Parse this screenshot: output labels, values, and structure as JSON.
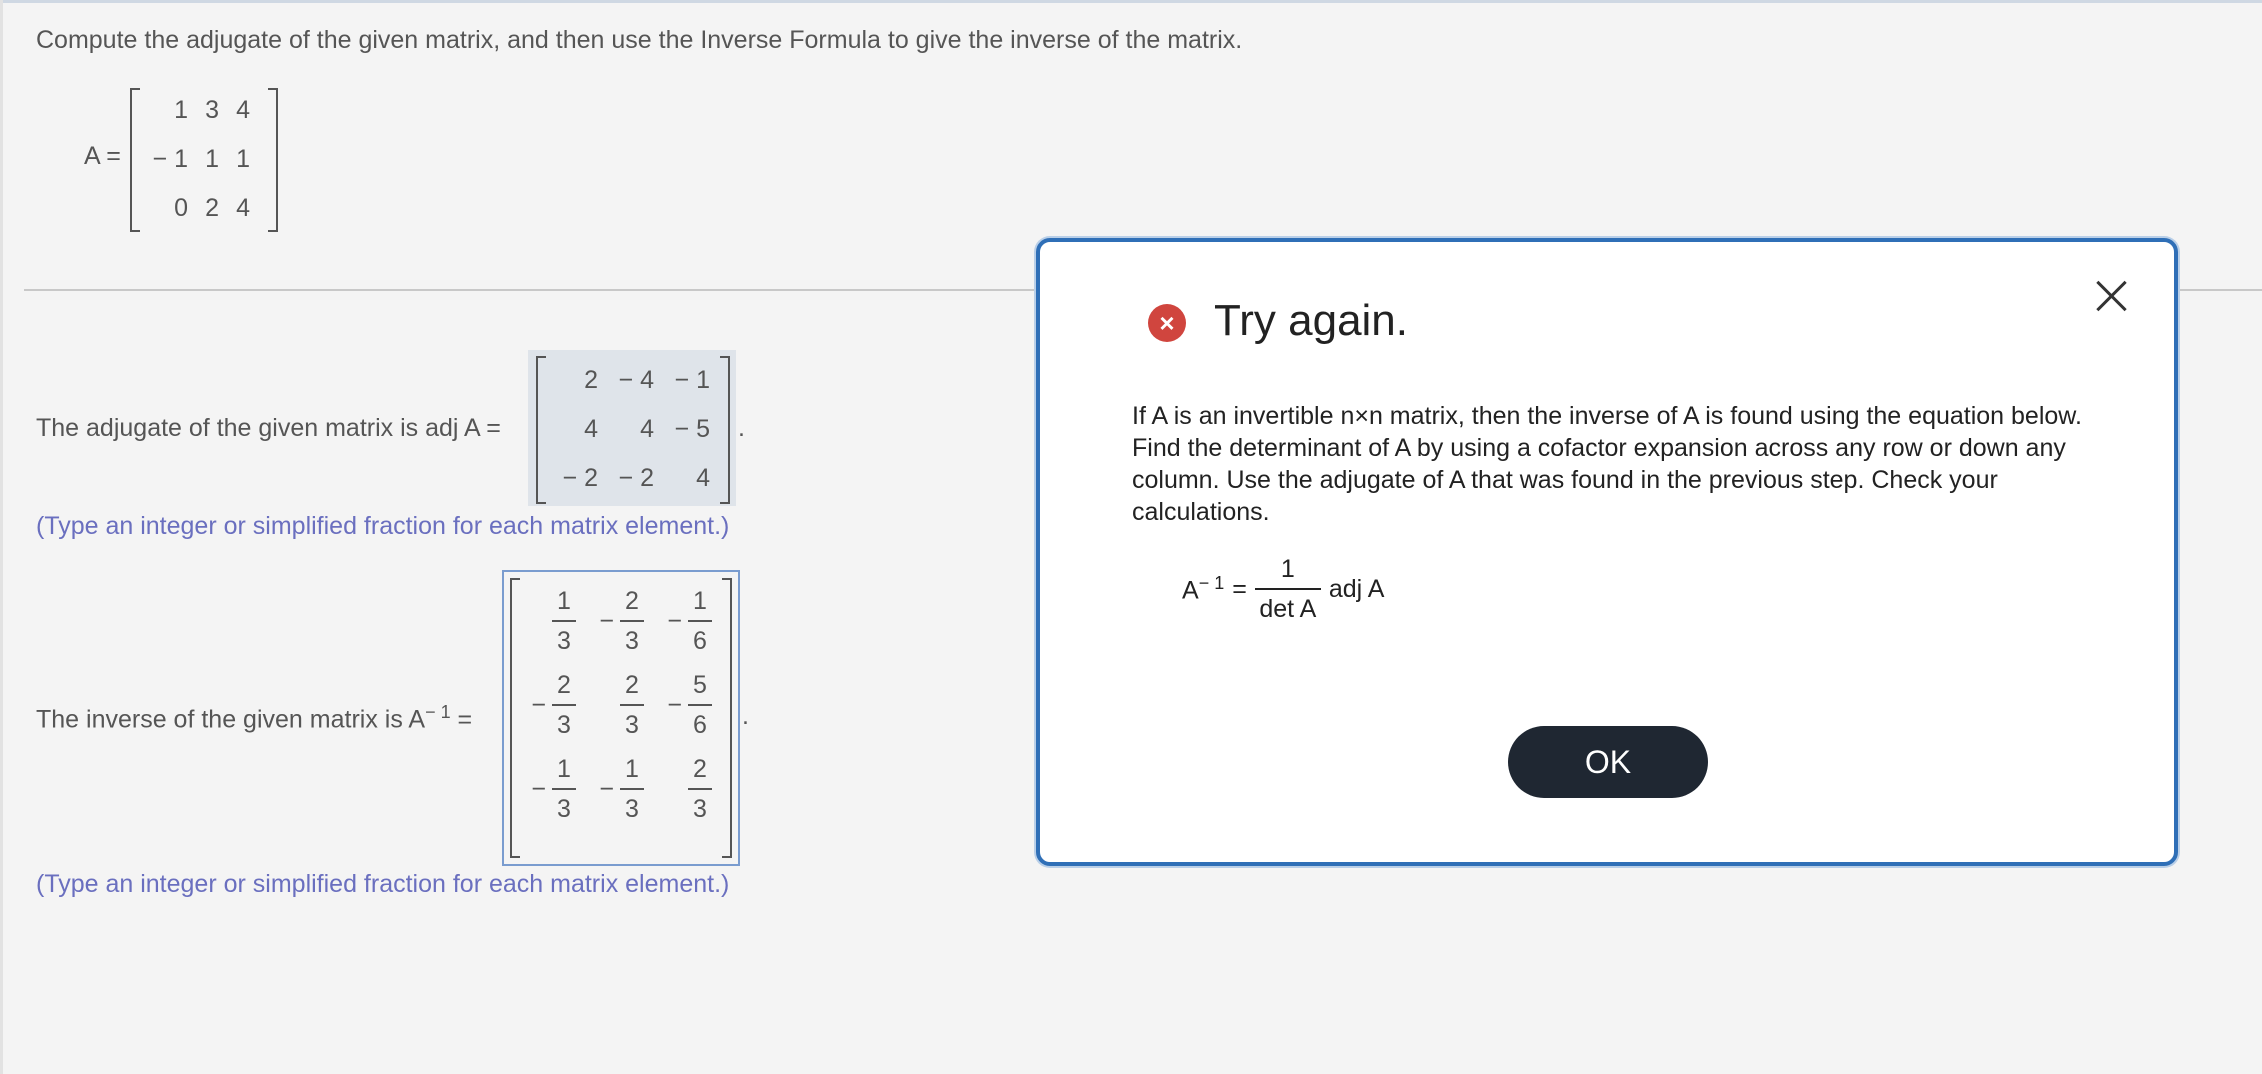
{
  "question": "Compute the adjugate of the given matrix, and then use the Inverse Formula to give the inverse of the matrix.",
  "matrix_a": {
    "label": "A =",
    "rows": [
      [
        "1",
        "3",
        "4"
      ],
      [
        "− 1",
        "1",
        "1"
      ],
      [
        "0",
        "2",
        "4"
      ]
    ]
  },
  "adjugate": {
    "prefix": "The adjugate of the given matrix is adj A =",
    "rows": [
      [
        "2",
        "− 4",
        "− 1"
      ],
      [
        "4",
        "4",
        "− 5"
      ],
      [
        "− 2",
        "− 2",
        "4"
      ]
    ],
    "suffix": ".",
    "hint": "(Type an integer or simplified fraction for each matrix element.)"
  },
  "inverse": {
    "prefix": "The inverse of the given matrix is A",
    "sup": "− 1",
    "eq": "=",
    "rows": [
      [
        {
          "s": "",
          "n": "1",
          "d": "3"
        },
        {
          "s": "−",
          "n": "2",
          "d": "3"
        },
        {
          "s": "−",
          "n": "1",
          "d": "6"
        }
      ],
      [
        {
          "s": "−",
          "n": "2",
          "d": "3"
        },
        {
          "s": "",
          "n": "2",
          "d": "3"
        },
        {
          "s": "−",
          "n": "5",
          "d": "6"
        }
      ],
      [
        {
          "s": "−",
          "n": "1",
          "d": "3"
        },
        {
          "s": "−",
          "n": "1",
          "d": "3"
        },
        {
          "s": "",
          "n": "2",
          "d": "3"
        }
      ]
    ],
    "suffix": ".",
    "hint": "(Type an integer or simplified fraction for each matrix element.)"
  },
  "dialog": {
    "title": "Try again.",
    "error_icon": "x-circle-icon",
    "body": "If A is an invertible n×n matrix, then the inverse of A is found using the equation below. Find the determinant of A by using a cofactor expansion across any row or down any column. Use the adjugate of A that was found in the previous step. Check your calculations.",
    "formula": {
      "lhs": "A",
      "sup": "− 1",
      "eq": "=",
      "num": "1",
      "den": "det A",
      "rhs": "adj A"
    },
    "ok_label": "OK",
    "close_icon": "close-icon"
  }
}
